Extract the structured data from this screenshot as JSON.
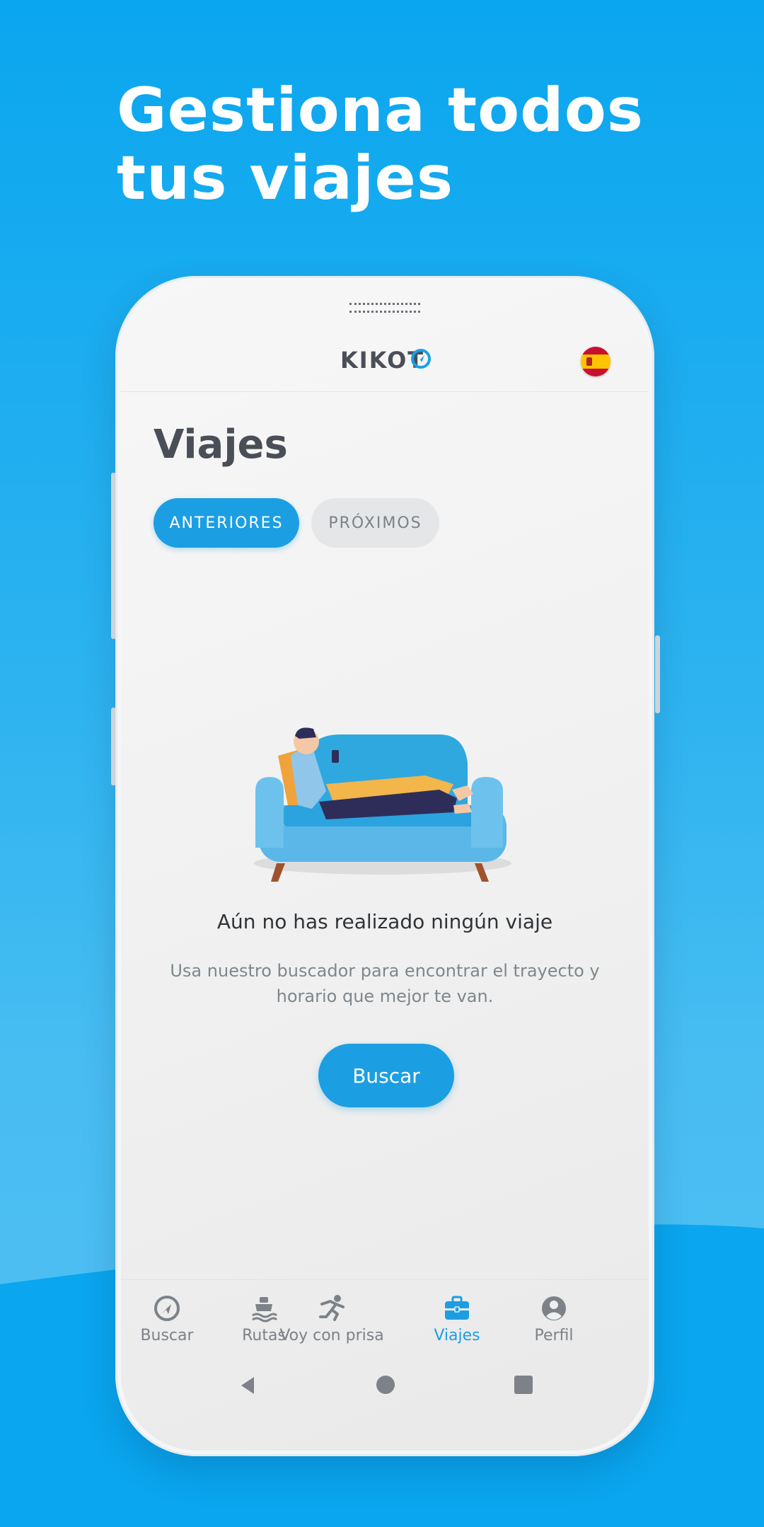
{
  "headline": {
    "line1": "Gestiona todos",
    "line2": "tus viajes"
  },
  "app": {
    "logo_text": "KIKOT",
    "language_flag_icon": "spain-flag-icon",
    "page_title": "Viajes",
    "tabs": [
      {
        "label": "ANTERIORES",
        "active": true
      },
      {
        "label": "PRÓXIMOS",
        "active": false
      }
    ],
    "empty_state": {
      "illustration_icon": "man-on-sofa-illustration",
      "title": "Aún no has realizado ningún viaje",
      "description": "Usa nuestro buscador para encontrar el trayecto y horario que mejor te van.",
      "button_label": "Buscar"
    },
    "bottom_nav": [
      {
        "label": "Buscar",
        "icon": "compass-icon",
        "active": false
      },
      {
        "label": "Rutas",
        "icon": "ship-icon",
        "active": false
      },
      {
        "label": "Voy con prisa",
        "icon": "running-person-icon",
        "active": false
      },
      {
        "label": "Viajes",
        "icon": "briefcase-icon",
        "active": true
      },
      {
        "label": "Perfil",
        "icon": "user-icon",
        "active": false
      }
    ],
    "system_nav": [
      "back-icon",
      "home-icon",
      "recents-icon"
    ]
  },
  "colors": {
    "background": "#0aa6ef",
    "accent": "#1c9ee3",
    "text_dark": "#2f3438",
    "text_muted": "#7e878d"
  }
}
